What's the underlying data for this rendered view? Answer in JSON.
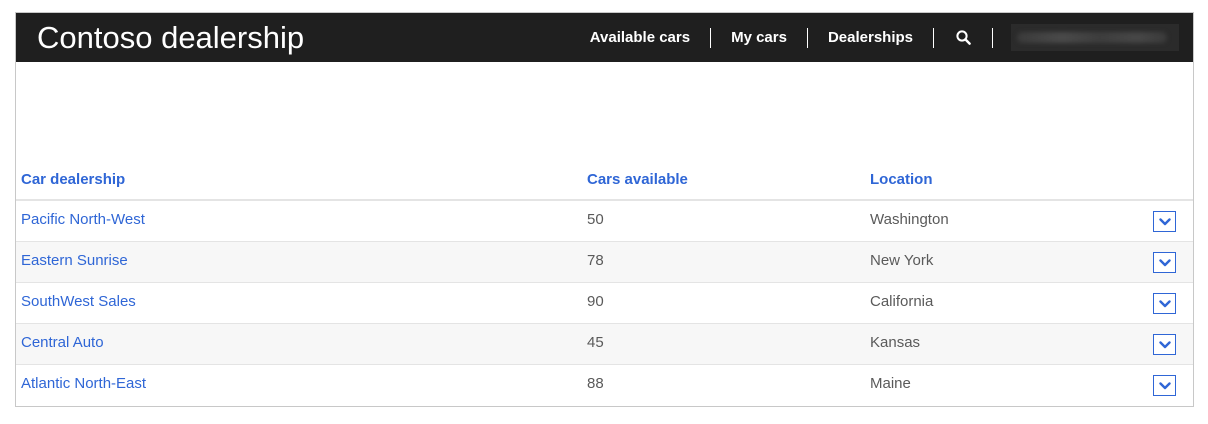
{
  "header": {
    "brand": "Contoso dealership",
    "nav": [
      {
        "label": "Available cars"
      },
      {
        "label": "My cars"
      },
      {
        "label": "Dealerships"
      }
    ],
    "search_icon": "search-icon",
    "user_name_blurred": true
  },
  "table": {
    "columns": [
      "Car dealership",
      "Cars available",
      "Location"
    ],
    "rows": [
      {
        "dealership": "Pacific North-West",
        "cars": "50",
        "location": "Washington"
      },
      {
        "dealership": "Eastern Sunrise",
        "cars": "78",
        "location": "New York"
      },
      {
        "dealership": "SouthWest Sales",
        "cars": "90",
        "location": "California"
      },
      {
        "dealership": "Central Auto",
        "cars": "45",
        "location": "Kansas"
      },
      {
        "dealership": "Atlantic North-East",
        "cars": "88",
        "location": "Maine"
      }
    ],
    "row_action_icon": "chevron-down-icon"
  },
  "colors": {
    "header_bg": "#1f1f1f",
    "accent": "#2f66d6",
    "text_muted": "#5a5a5a",
    "row_alt_bg": "#f7f7f7"
  }
}
